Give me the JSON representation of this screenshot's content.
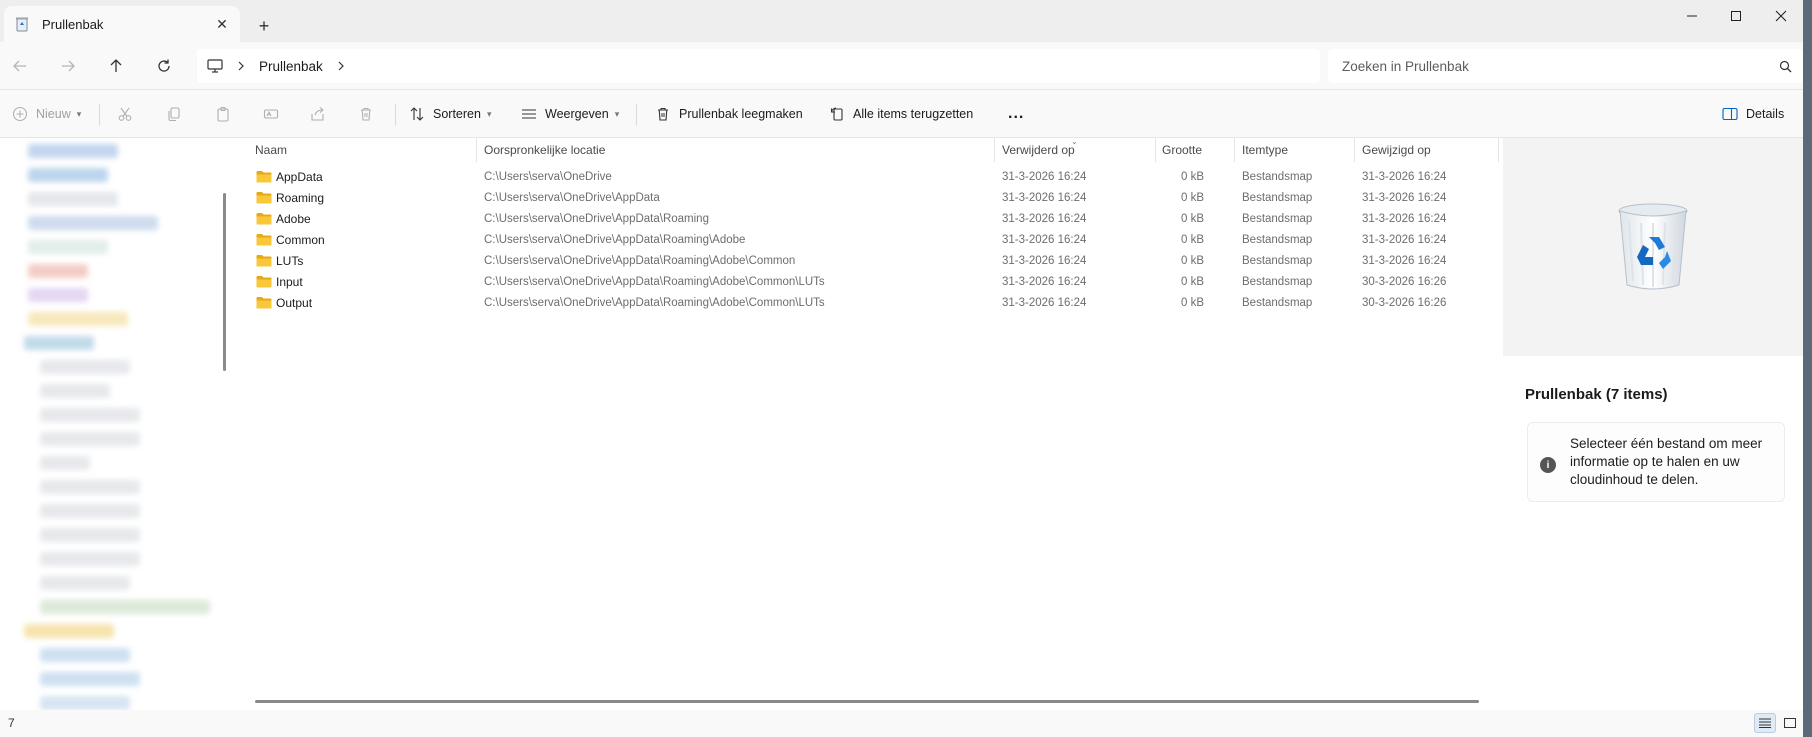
{
  "window": {
    "tab_title": "Prullenbak",
    "new_tab_label": "+",
    "tab_close_label": "✕"
  },
  "address": {
    "breadcrumb_root_icon": "computer-icon",
    "crumbs": [
      "Prullenbak"
    ],
    "search_placeholder": "Zoeken in Prullenbak"
  },
  "commands": {
    "new_label": "Nieuw",
    "sort_label": "Sorteren",
    "view_label": "Weergeven",
    "empty_bin_label": "Prullenbak leegmaken",
    "restore_all_label": "Alle items terugzetten",
    "more_label": "...",
    "details_label": "Details"
  },
  "columns": {
    "name": "Naam",
    "original_location": "Oorspronkelijke locatie",
    "deleted_on": "Verwijderd op",
    "size": "Grootte",
    "item_type": "Itemtype",
    "modified_on": "Gewijzigd op"
  },
  "files": [
    {
      "name": "AppData",
      "location": "C:\\Users\\serva\\OneDrive",
      "deleted": "31-3-2026 16:24",
      "size": "0 kB",
      "type": "Bestandsmap",
      "modified": "31-3-2026 16:24"
    },
    {
      "name": "Roaming",
      "location": "C:\\Users\\serva\\OneDrive\\AppData",
      "deleted": "31-3-2026 16:24",
      "size": "0 kB",
      "type": "Bestandsmap",
      "modified": "31-3-2026 16:24"
    },
    {
      "name": "Adobe",
      "location": "C:\\Users\\serva\\OneDrive\\AppData\\Roaming",
      "deleted": "31-3-2026 16:24",
      "size": "0 kB",
      "type": "Bestandsmap",
      "modified": "31-3-2026 16:24"
    },
    {
      "name": "Common",
      "location": "C:\\Users\\serva\\OneDrive\\AppData\\Roaming\\Adobe",
      "deleted": "31-3-2026 16:24",
      "size": "0 kB",
      "type": "Bestandsmap",
      "modified": "31-3-2026 16:24"
    },
    {
      "name": "LUTs",
      "location": "C:\\Users\\serva\\OneDrive\\AppData\\Roaming\\Adobe\\Common",
      "deleted": "31-3-2026 16:24",
      "size": "0 kB",
      "type": "Bestandsmap",
      "modified": "31-3-2026 16:24"
    },
    {
      "name": "Input",
      "location": "C:\\Users\\serva\\OneDrive\\AppData\\Roaming\\Adobe\\Common\\LUTs",
      "deleted": "31-3-2026 16:24",
      "size": "0 kB",
      "type": "Bestandsmap",
      "modified": "30-3-2026 16:26"
    },
    {
      "name": "Output",
      "location": "C:\\Users\\serva\\OneDrive\\AppData\\Roaming\\Adobe\\Common\\LUTs",
      "deleted": "31-3-2026 16:24",
      "size": "0 kB",
      "type": "Bestandsmap",
      "modified": "30-3-2026 16:26"
    }
  ],
  "details_pane": {
    "title": "Prullenbak (7 items)",
    "info_icon_glyph": "i",
    "info_text": "Selecteer één bestand om meer informatie op te halen en uw cloudinhoud te delen."
  },
  "status": {
    "item_count": "7"
  },
  "colors": {
    "accent": "#0067c0",
    "folder_yellow": "#f8c83a",
    "chrome_bg": "#f9f9f9",
    "titlebar_bg": "#eeeeee"
  }
}
